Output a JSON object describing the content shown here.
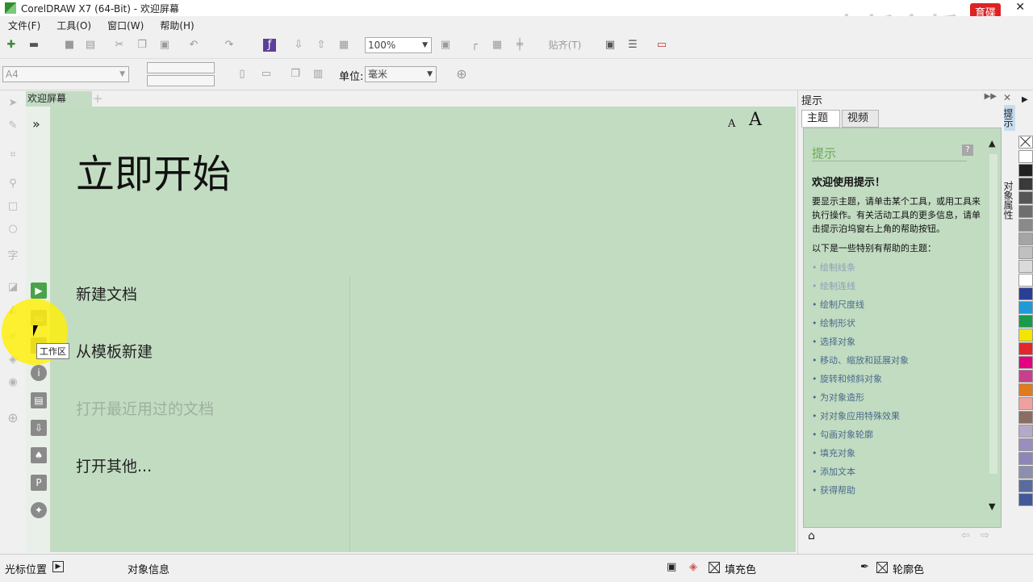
{
  "window": {
    "title": "CorelDRAW X7 (64-Bit) - 欢迎屏幕",
    "close": "✕"
  },
  "menu": [
    "文件(F)",
    "工具(O)",
    "窗口(W)",
    "帮助(H)"
  ],
  "toolbar": {
    "zoom": "100%",
    "snap": "贴齐(T)"
  },
  "propbar": {
    "page_size": "A4",
    "unit_label": "单位:",
    "unit_value": "毫米"
  },
  "tabs": {
    "welcome": "欢迎屏幕",
    "add": "+"
  },
  "main": {
    "collapse": "»",
    "font_small": "A",
    "font_large": "A",
    "heading": "立即开始",
    "items": [
      {
        "label": "新建文档",
        "enabled": true
      },
      {
        "label": "从模板新建",
        "enabled": true
      },
      {
        "label": "打开最近用过的文档",
        "enabled": false
      },
      {
        "label": "打开其他...",
        "enabled": true
      }
    ]
  },
  "tooltip": "工作区",
  "hints_docker": {
    "title": "提示",
    "tabs": [
      "主题",
      "视频"
    ],
    "pane_heading": "提示",
    "help_icon": "?",
    "welcome": "欢迎使用提示！",
    "paragraph": "要显示主题，请单击某个工具，或用工具来执行操作。有关活动工具的更多信息，请单击提示泊坞窗右上角的帮助按钮。",
    "subheading": "以下是一些特别有帮助的主题：",
    "links": [
      "绘制线条",
      "绘制连线",
      "绘制尺度线",
      "绘制形状",
      "选择对象",
      "移动、缩放和延展对象",
      "旋转和倾斜对象",
      "为对象造形",
      "对对象应用特殊效果",
      "勾画对象轮廓",
      "填充对象",
      "添加文本",
      "获得帮助"
    ]
  },
  "side_tabs": {
    "hints": "提示",
    "object_props": "对象属性"
  },
  "watermark": {
    "text": "中新金桥",
    "logo": "育碟软件"
  },
  "status": {
    "cursor_pos": "光标位置",
    "object_info": "对象信息",
    "fill": "填充色",
    "outline": "轮廓色"
  },
  "palette": [
    "#ffffff",
    "#222222",
    "#3a3a3a",
    "#555555",
    "#6e6e6e",
    "#8a8a8a",
    "#a5a5a5",
    "#c0c0c0",
    "#dadada",
    "#ffffff",
    "#2b3e96",
    "#1f9ad6",
    "#1a9a4a",
    "#f2e600",
    "#e3262d",
    "#e4007f",
    "#c8408c",
    "#e07b20",
    "#f0a0a0",
    "#8a6e63",
    "#b5a8c8",
    "#9a8ec0",
    "#8e86b8",
    "#8c8fb0",
    "#5a6c9e",
    "#43589a"
  ]
}
